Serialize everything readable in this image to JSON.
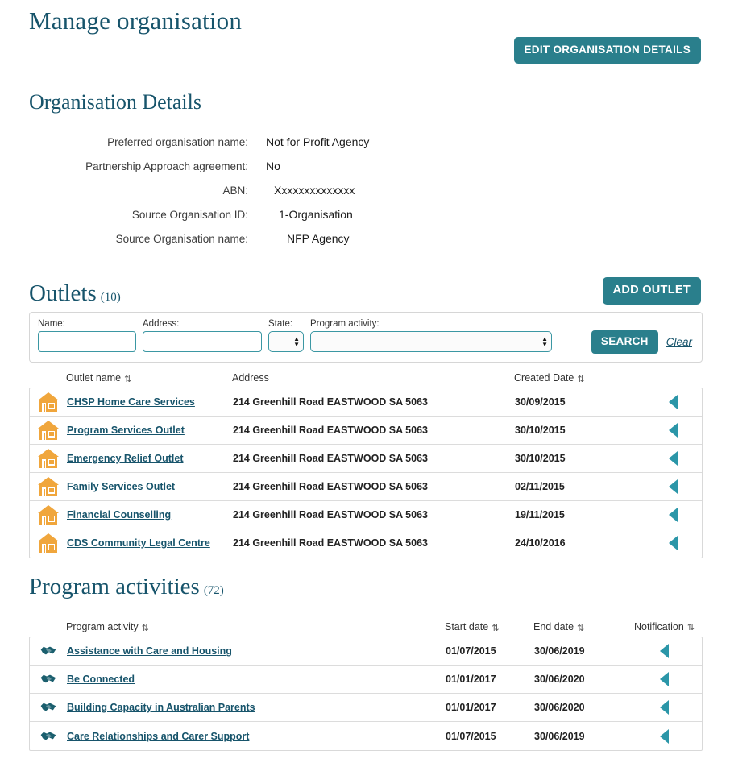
{
  "header": {
    "title": "Manage organisation",
    "edit_button": "EDIT ORGANISATION DETAILS"
  },
  "organisation_details": {
    "heading": "Organisation Details",
    "fields": [
      {
        "label": "Preferred organisation name:",
        "value": "Not for Profit Agency"
      },
      {
        "label": "Partnership Approach agreement:",
        "value": "No"
      },
      {
        "label": "ABN:",
        "value": "Xxxxxxxxxxxxxx"
      },
      {
        "label": "Source Organisation ID:",
        "value": "1-Organisation"
      },
      {
        "label": "Source Organisation name:",
        "value": "NFP Agency"
      }
    ]
  },
  "outlets": {
    "heading": "Outlets",
    "count": "(10)",
    "add_button": "ADD OUTLET",
    "search": {
      "name_label": "Name:",
      "name_value": "",
      "address_label": "Address:",
      "address_value": "",
      "state_label": "State:",
      "state_value": "",
      "activity_label": "Program activity:",
      "activity_value": "",
      "search_button": "SEARCH",
      "clear_link": "Clear"
    },
    "columns": {
      "name": "Outlet name",
      "address": "Address",
      "created": "Created Date"
    },
    "rows": [
      {
        "icon": "house-icon",
        "name": "CHSP Home Care Services",
        "address": "214 Greenhill Road EASTWOOD SA 5063",
        "created": "30/09/2015"
      },
      {
        "icon": "house-icon",
        "name": "Program Services Outlet",
        "address": "214 Greenhill Road EASTWOOD SA 5063",
        "created": "30/10/2015"
      },
      {
        "icon": "house-icon",
        "name": "Emergency Relief Outlet",
        "address": "214 Greenhill Road EASTWOOD SA 5063",
        "created": "30/10/2015"
      },
      {
        "icon": "house-icon",
        "name": "Family Services Outlet",
        "address": "214 Greenhill Road EASTWOOD SA 5063",
        "created": "02/11/2015"
      },
      {
        "icon": "house-icon",
        "name": "Financial Counselling",
        "address": "214 Greenhill Road EASTWOOD SA 5063",
        "created": "19/11/2015"
      },
      {
        "icon": "house-icon",
        "name": "CDS Community Legal Centre",
        "address": "214 Greenhill Road EASTWOOD SA 5063",
        "created": "24/10/2016"
      }
    ]
  },
  "program_activities": {
    "heading": "Program activities",
    "count": "(72)",
    "columns": {
      "activity": "Program activity",
      "start": "Start date",
      "end": "End date",
      "notification": "Notification"
    },
    "rows": [
      {
        "icon": "handshake-icon",
        "activity": "Assistance with Care and Housing",
        "start": "01/07/2015",
        "end": "30/06/2019"
      },
      {
        "icon": "handshake-icon",
        "activity": "Be Connected",
        "start": "01/01/2017",
        "end": "30/06/2020"
      },
      {
        "icon": "handshake-icon",
        "activity": "Building Capacity in Australian Parents",
        "start": "01/01/2017",
        "end": "30/06/2020"
      },
      {
        "icon": "handshake-icon",
        "activity": "Care Relationships and Carer Support",
        "start": "01/07/2015",
        "end": "30/06/2019"
      }
    ]
  },
  "icons": {
    "sort": "⇅",
    "spinner_up": "▲",
    "spinner_down": "▼"
  },
  "colors": {
    "teal": "#2a7f8c",
    "heading": "#17546b",
    "orange": "#f0a63c",
    "caret": "#2b96a8"
  }
}
